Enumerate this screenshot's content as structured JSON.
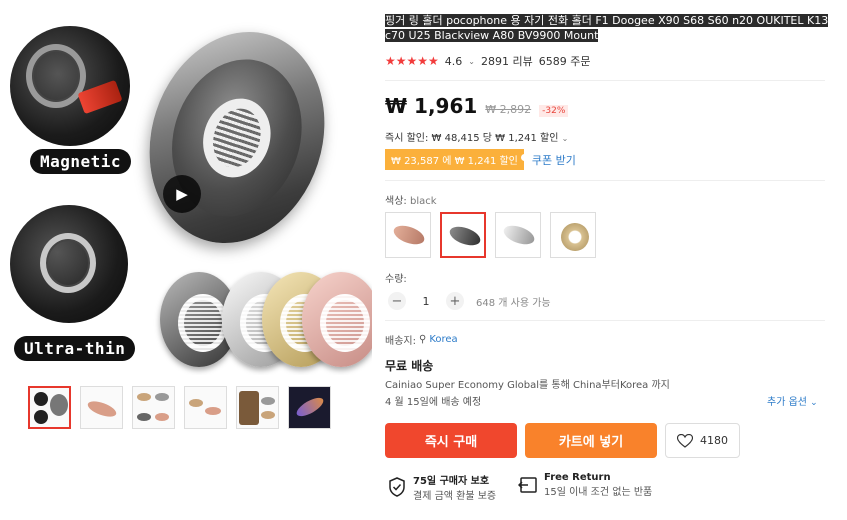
{
  "product": {
    "title": "핑거 링 홀더 pocophone 용 자기 전화 홀더 F1 Doogee X90 S68 S60 n20 OUKITEL K13 c70 U25 Blackview A80 BV9900 Mount",
    "rating": "4.6",
    "reviews": "2891 리뷰",
    "orders": "6589 주문",
    "price": "₩ 1,961",
    "old_price": "₩ 2,892",
    "discount": "-32%",
    "instant_discount": "즉시 할인: ₩ 48,415 당 ₩ 1,241 할인",
    "coupon_badge": "₩ 23,587 에 ₩ 1,241 할인",
    "coupon_link": "쿠폰 받기"
  },
  "gallery": {
    "label_magnetic": "Magnetic",
    "label_ultrathin": "Ultra-thin"
  },
  "options": {
    "color_label": "색상:",
    "color_value": "black",
    "quantity_label": "수량:",
    "quantity": "1",
    "available": "648 개 사용 가능"
  },
  "shipping": {
    "ship_to_label": "배송지:",
    "country": "Korea",
    "free": "무료 배송",
    "desc": "Cainiao Super Economy Global를 통해 China부터Korea 까지",
    "date": "4 월 15일에 배송 예정",
    "more": "추가 옵션"
  },
  "actions": {
    "buy": "즉시 구매",
    "cart": "카트에 넣기",
    "wish_count": "4180"
  },
  "guarantees": [
    {
      "title": "75일 구매자 보호",
      "sub": "결제 금액 환불 보증"
    },
    {
      "title": "Free Return",
      "sub": "15일 이내 조건 없는 반품"
    }
  ],
  "colors": {
    "accent": "#f0472d",
    "cart": "#f9822b",
    "link": "#2e7cc9",
    "coupon": "#fbb03b"
  }
}
